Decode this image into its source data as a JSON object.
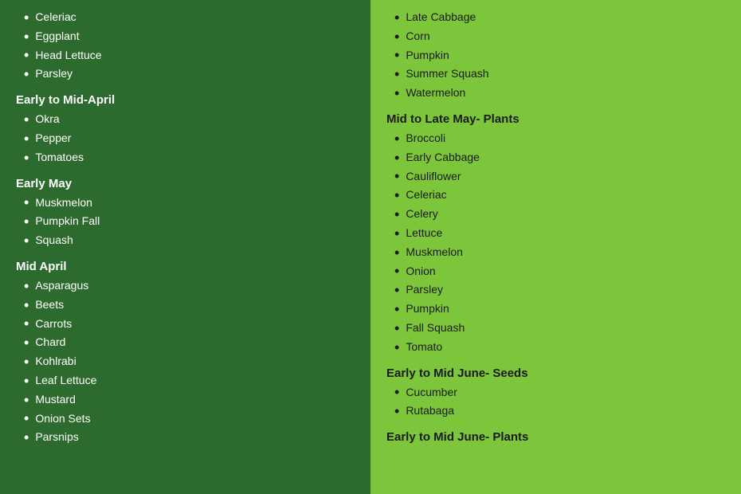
{
  "left": {
    "sections": [
      {
        "heading": null,
        "items": [
          "Celeriac",
          "Eggplant",
          "Head Lettuce",
          "Parsley"
        ]
      },
      {
        "heading": "Early to Mid-April",
        "items": [
          "Okra",
          "Pepper",
          "Tomatoes"
        ]
      },
      {
        "heading": "Early May",
        "items": [
          "Muskmelon",
          "Pumpkin Fall",
          "Squash"
        ]
      },
      {
        "heading": "Mid April",
        "items": [
          "Asparagus",
          "Beets",
          "Carrots",
          "Chard",
          "Kohlrabi",
          "Leaf Lettuce",
          "Mustard",
          "Onion Sets",
          "Parsnips"
        ]
      }
    ]
  },
  "right": {
    "sections": [
      {
        "heading": null,
        "items": [
          "Late Cabbage",
          "Corn",
          "Pumpkin",
          "Summer Squash",
          "Watermelon"
        ]
      },
      {
        "heading": "Mid to Late May- Plants",
        "items": [
          "Broccoli",
          "Early Cabbage",
          "Cauliflower",
          "Celeriac",
          "Celery",
          "Lettuce",
          "Muskmelon",
          "Onion",
          "Parsley",
          "Pumpkin",
          "Fall Squash",
          "Tomato"
        ]
      },
      {
        "heading": "Early to Mid June- Seeds",
        "items": [
          "Cucumber",
          "Rutabaga"
        ]
      },
      {
        "heading": "Early to Mid June- Plants",
        "items": []
      }
    ]
  }
}
